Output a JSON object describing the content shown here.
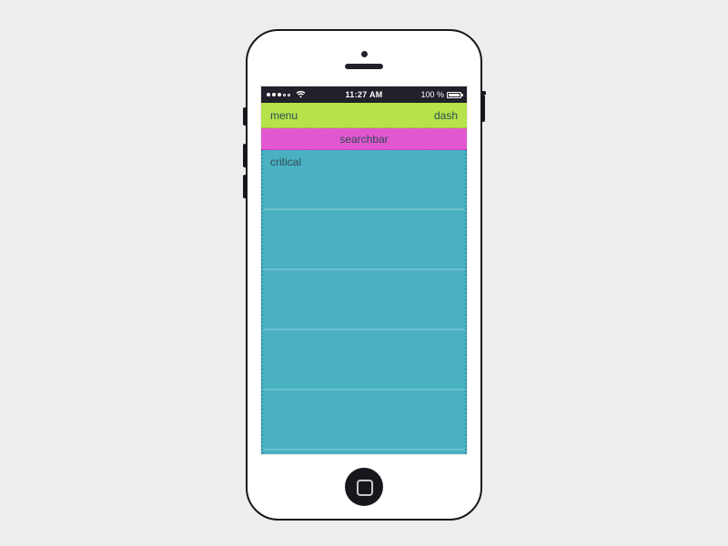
{
  "status": {
    "time": "11:27 AM",
    "battery_pct": "100 %"
  },
  "nav": {
    "menu_label": "menu",
    "dash_label": "dash"
  },
  "search": {
    "label": "searchbar"
  },
  "rows": {
    "0": "critical",
    "1": "",
    "2": "",
    "3": "",
    "4": ""
  },
  "colors": {
    "nav": "#b6e24a",
    "search": "#e257cf",
    "list": "#49b1c2",
    "status": "#20212a"
  }
}
